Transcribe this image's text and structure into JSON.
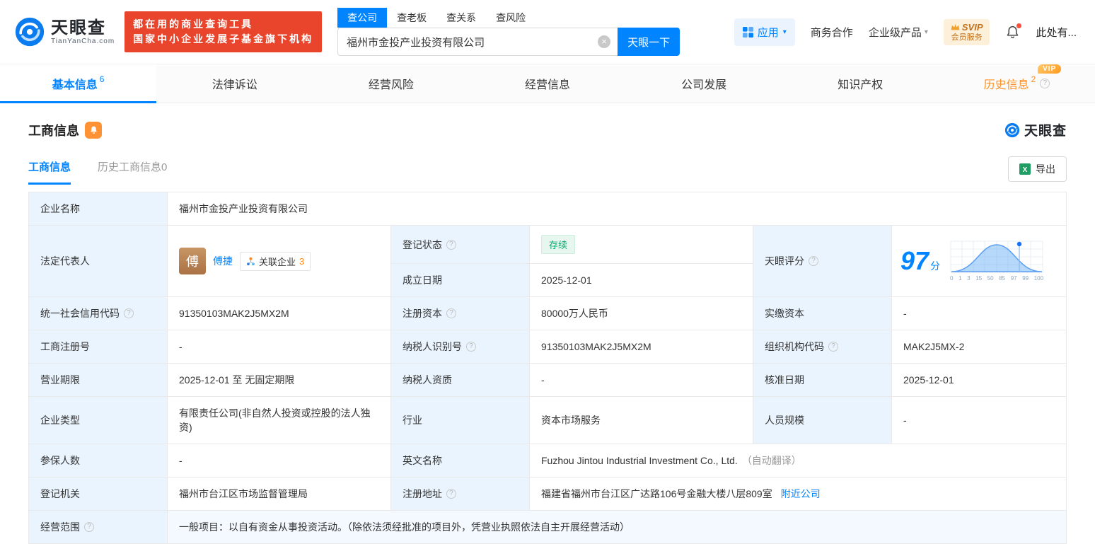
{
  "colors": {
    "accent": "#0084ff",
    "slogan_red": "#e9452c",
    "status_green": "#0aa96c",
    "vip_orange": "#ff9021",
    "label_bg": "#eaf4fe"
  },
  "header": {
    "logo": {
      "brand": "天眼查",
      "domain": "TianYanCha.com"
    },
    "slogan": {
      "line1": "都在用的商业查询工具",
      "line2": "国家中小企业发展子基金旗下机构"
    },
    "search": {
      "tabs": [
        {
          "label": "查公司"
        },
        {
          "label": "查老板"
        },
        {
          "label": "查关系"
        },
        {
          "label": "查风险"
        }
      ],
      "value": "福州市金投产业投资有限公司",
      "button": "天眼一下"
    },
    "right": {
      "apps": "应用",
      "coop": "商务合作",
      "enterprise": "企业级产品",
      "svip_line1": "SVIP",
      "svip_line2": "会员服务",
      "user": "此处有..."
    }
  },
  "nav_tabs": [
    {
      "label": "基本信息",
      "count": "6"
    },
    {
      "label": "法律诉讼"
    },
    {
      "label": "经营风险"
    },
    {
      "label": "经营信息"
    },
    {
      "label": "公司发展"
    },
    {
      "label": "知识产权"
    },
    {
      "label": "历史信息",
      "count": "2",
      "vip": "VIP"
    }
  ],
  "section": {
    "title": "工商信息",
    "brand": "天眼查",
    "sub_tabs": [
      {
        "label": "工商信息"
      },
      {
        "label": "历史工商信息",
        "count": "0"
      }
    ],
    "export_label": "导出"
  },
  "fields": {
    "company_name": {
      "label": "企业名称",
      "value": "福州市金投产业投资有限公司"
    },
    "legal_rep": {
      "label": "法定代表人",
      "avatar": "傅",
      "name": "傅捷",
      "related_label": "关联企业",
      "related_count": "3"
    },
    "reg_status": {
      "label": "登记状态",
      "value": "存续"
    },
    "establish_date": {
      "label": "成立日期",
      "value": "2025-12-01"
    },
    "score": {
      "label": "天眼评分",
      "value": "97",
      "unit": "分",
      "axis": [
        "0",
        "1",
        "3",
        "15",
        "50",
        "85",
        "97",
        "99",
        "100"
      ]
    },
    "credit_code": {
      "label": "统一社会信用代码",
      "value": "91350103MAK2J5MX2M"
    },
    "reg_capital": {
      "label": "注册资本",
      "value": "80000万人民币"
    },
    "paid_capital": {
      "label": "实缴资本",
      "value": "-"
    },
    "reg_number": {
      "label": "工商注册号",
      "value": "-"
    },
    "taxpayer_id": {
      "label": "纳税人识别号",
      "value": "91350103MAK2J5MX2M"
    },
    "org_code": {
      "label": "组织机构代码",
      "value": "MAK2J5MX-2"
    },
    "business_term": {
      "label": "营业期限",
      "value": "2025-12-01 至 无固定期限"
    },
    "taxpayer_quality": {
      "label": "纳税人资质",
      "value": "-"
    },
    "approval_date": {
      "label": "核准日期",
      "value": "2025-12-01"
    },
    "company_type": {
      "label": "企业类型",
      "value": "有限责任公司(非自然人投资或控股的法人独资)"
    },
    "industry": {
      "label": "行业",
      "value": "资本市场服务"
    },
    "staff_size": {
      "label": "人员规模",
      "value": "-"
    },
    "insured_count": {
      "label": "参保人数",
      "value": "-"
    },
    "english_name": {
      "label": "英文名称",
      "value": "Fuzhou Jintou Industrial Investment Co., Ltd.",
      "note": "（自动翻译）"
    },
    "reg_authority": {
      "label": "登记机关",
      "value": "福州市台江区市场监督管理局"
    },
    "reg_address": {
      "label": "注册地址",
      "value": "福建省福州市台江区广达路106号金融大楼八层809室",
      "link": "附近公司"
    },
    "business_scope": {
      "label": "经营范围",
      "value": "一般项目：以自有资金从事投资活动。（除依法须经批准的项目外，凭营业执照依法自主开展经营活动）"
    }
  }
}
